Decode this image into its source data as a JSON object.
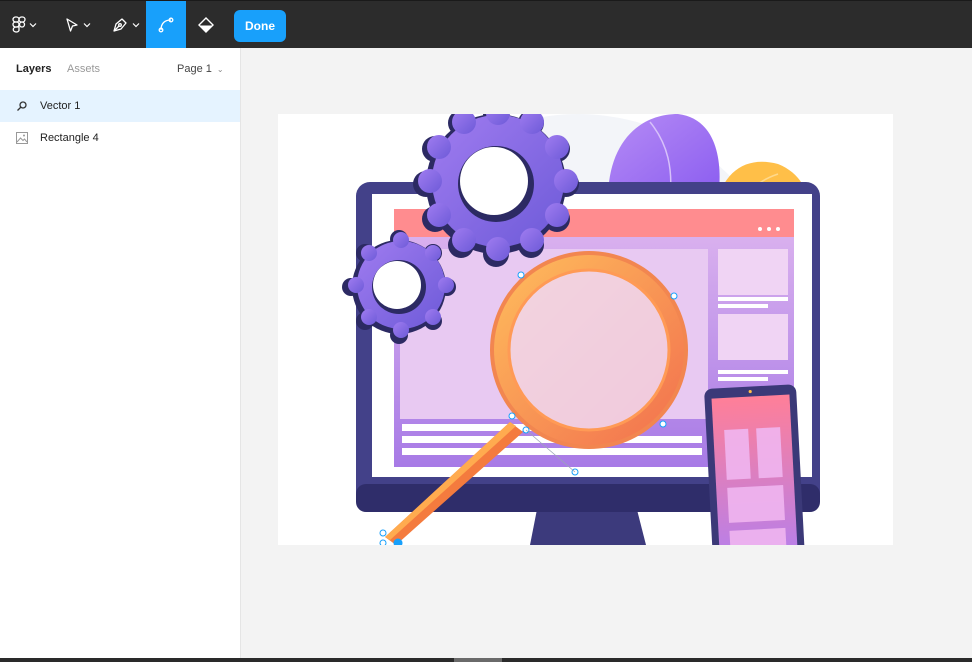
{
  "toolbar": {
    "main_menu_icon": "figma-logo-icon",
    "move_tool_icon": "cursor-arrow-icon",
    "pen_tool_icon": "pen-tool-icon",
    "bend_tool_icon": "bend-path-icon",
    "paint_bucket_icon": "paint-bucket-icon",
    "done_label": "Done"
  },
  "left_panel": {
    "tabs": {
      "layers": "Layers",
      "assets": "Assets"
    },
    "page_select": "Page 1",
    "layers": [
      {
        "name": "Vector 1",
        "icon": "search-vector-icon",
        "selected": true
      },
      {
        "name": "Rectangle 4",
        "icon": "image-icon",
        "selected": false
      }
    ]
  },
  "canvas": {
    "frame_image": "illustration-monitor-magnifier-gears-phone"
  },
  "colors": {
    "accent": "#18a0fb",
    "toolbar_bg": "#2c2c2c",
    "selected_row_bg": "#e5f3ff",
    "canvas_bg": "#f3f3f3"
  }
}
